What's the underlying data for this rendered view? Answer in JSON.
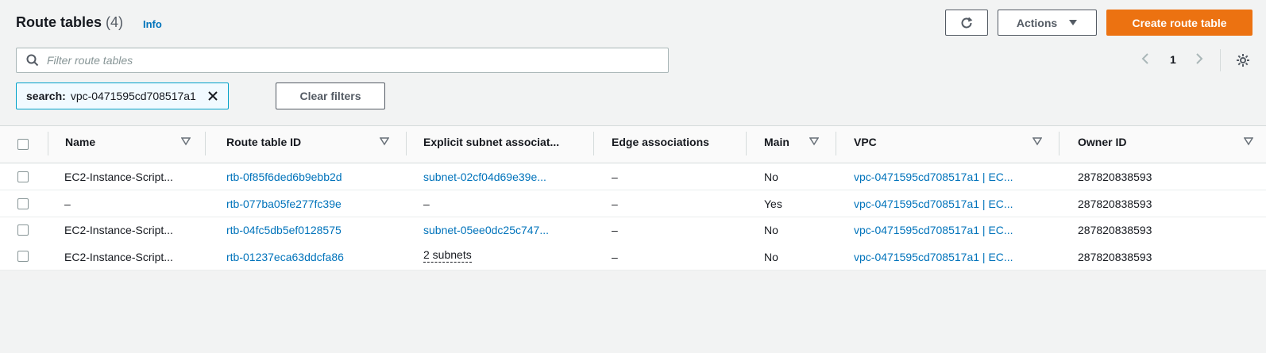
{
  "header": {
    "title": "Route tables",
    "count": "(4)",
    "info": "Info",
    "actions_label": "Actions",
    "create_label": "Create route table"
  },
  "filter": {
    "placeholder": "Filter route tables",
    "token_key": "search:",
    "token_value": "vpc-0471595cd708517a1",
    "clear_label": "Clear filters"
  },
  "pagination": {
    "page": "1"
  },
  "table": {
    "columns": [
      "Name",
      "Route table ID",
      "Explicit subnet associat...",
      "Edge associations",
      "Main",
      "VPC",
      "Owner ID"
    ],
    "rows": [
      {
        "name": "EC2-Instance-Script...",
        "id": "rtb-0f85f6ded6b9ebb2d",
        "subnet": "subnet-02cf04d69e39e...",
        "edge": "–",
        "main": "No",
        "vpc": "vpc-0471595cd708517a1 | EC...",
        "owner": "287820838593"
      },
      {
        "name": "–",
        "id": "rtb-077ba05fe277fc39e",
        "subnet": "–",
        "edge": "–",
        "main": "Yes",
        "vpc": "vpc-0471595cd708517a1 | EC...",
        "owner": "287820838593"
      },
      {
        "name": "EC2-Instance-Script...",
        "id": "rtb-04fc5db5ef0128575",
        "subnet": "subnet-05ee0dc25c747...",
        "edge": "–",
        "main": "No",
        "vpc": "vpc-0471595cd708517a1 | EC...",
        "owner": "287820838593"
      },
      {
        "name": "EC2-Instance-Script...",
        "id": "rtb-01237eca63ddcfa86",
        "subnet": "2 subnets",
        "edge": "–",
        "main": "No",
        "vpc": "vpc-0471595cd708517a1 | EC...",
        "owner": "287820838593"
      }
    ]
  },
  "colors": {
    "accent": "#ec7211",
    "link": "#0073bb"
  }
}
